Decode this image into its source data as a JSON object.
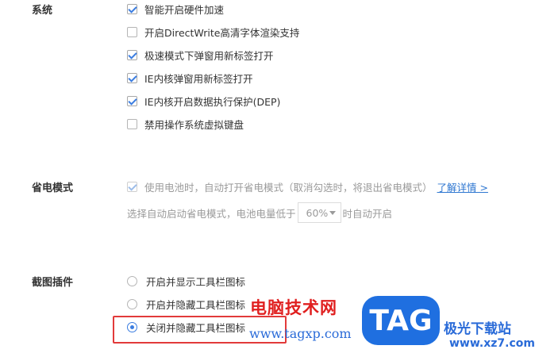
{
  "system": {
    "label": "系统",
    "options": [
      {
        "label": "智能开启硬件加速",
        "checked": true
      },
      {
        "label": "开启DirectWrite高清字体渲染支持",
        "checked": false
      },
      {
        "label": "极速模式下弹窗用新标签打开",
        "checked": true
      },
      {
        "label": "IE内核弹窗用新标签打开",
        "checked": true
      },
      {
        "label": "IE内核开启数据执行保护(DEP)",
        "checked": true
      },
      {
        "label": "禁用操作系统虚拟键盘",
        "checked": false
      }
    ]
  },
  "power_saving": {
    "label": "省电模式",
    "battery_option": {
      "label": "使用电池时，自动打开省电模式（取消勾选时，将退出省电模式）",
      "checked": true,
      "disabled": true
    },
    "learn_more": "了解详情 >",
    "threshold_prefix": "选择自动启动省电模式，电池电量低于",
    "threshold_value": "60%",
    "threshold_suffix": "时自动开启"
  },
  "screenshot_plugin": {
    "label": "截图插件",
    "options": [
      {
        "label": "开启并显示工具栏图标",
        "selected": false
      },
      {
        "label": "开启并隐藏工具栏图标",
        "selected": false
      },
      {
        "label": "关闭并隐藏工具栏图标",
        "selected": true
      }
    ]
  },
  "watermark": {
    "site_cn": "电脑技术网",
    "url": "www.tagxp.com",
    "logo_text": "TAG",
    "site2_cn": "极光下载站",
    "site2_url": "www.xz7.com"
  },
  "colors": {
    "accent": "#3b7de0",
    "highlight": "#e23a3a",
    "watermark_red": "#e01f1f",
    "watermark_blue": "#2a6bd8"
  }
}
